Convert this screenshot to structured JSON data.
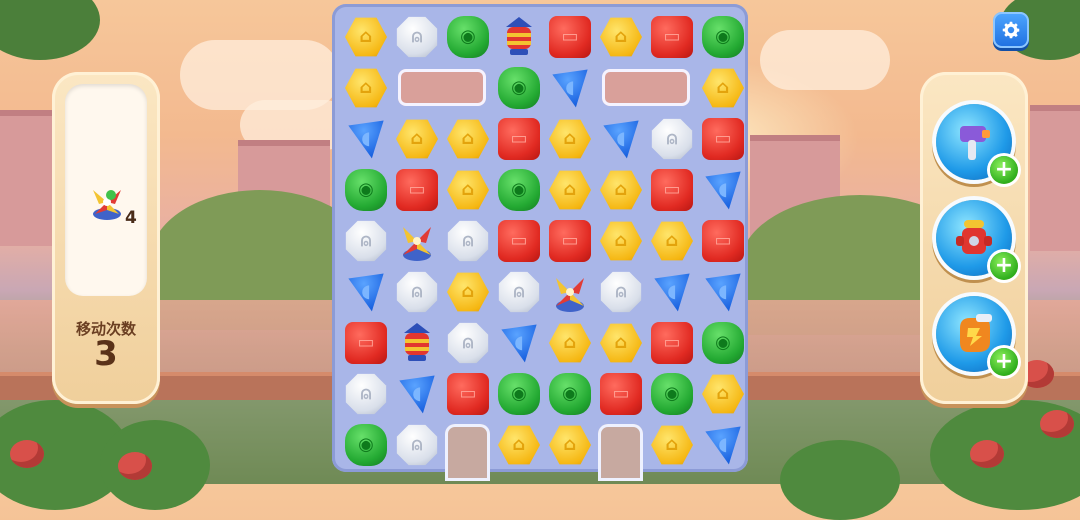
{
  "left_panel": {
    "goal_icon": "pinwheel-icon",
    "goal_count": "4",
    "moves_label": "移动次数",
    "moves_value": "3"
  },
  "settings": {
    "icon": "gear-icon"
  },
  "boosters": [
    {
      "name": "hammer-booster",
      "icon": "hammer-icon",
      "add_label": "+"
    },
    {
      "name": "fire-hydrant-booster",
      "icon": "fire-hydrant-icon",
      "add_label": "+"
    },
    {
      "name": "glove-booster",
      "icon": "glove-icon",
      "add_label": "+"
    }
  ],
  "board": {
    "columns": 8,
    "rows": 9,
    "tiles": [
      [
        "yellow",
        "white",
        "green",
        "lantern",
        "red",
        "yellow",
        "red",
        "green"
      ],
      [
        "yellow",
        "gap",
        "gap",
        "green",
        "blue",
        "gap",
        "gap",
        "yellow"
      ],
      [
        "blue",
        "yellow",
        "yellow",
        "red",
        "yellow",
        "blue",
        "white",
        "red"
      ],
      [
        "green",
        "red",
        "yellow",
        "green",
        "yellow",
        "yellow",
        "red",
        "blue"
      ],
      [
        "white",
        "pinwheel",
        "white",
        "red",
        "red",
        "yellow",
        "yellow",
        "red"
      ],
      [
        "blue",
        "white",
        "yellow",
        "white",
        "pinwheel",
        "white",
        "blue",
        "blue"
      ],
      [
        "red",
        "lantern",
        "white",
        "blue",
        "yellow",
        "yellow",
        "red",
        "green"
      ],
      [
        "white",
        "blue",
        "red",
        "green",
        "green",
        "red",
        "green",
        "yellow"
      ],
      [
        "green",
        "white",
        "none",
        "yellow",
        "yellow",
        "none",
        "yellow",
        "blue"
      ]
    ]
  },
  "colors": {
    "board_bg": "#a9b6e8",
    "panel_bg": "#fbe7c3",
    "accent_blue": "#1e6fe0",
    "plus_green": "#2fae1d"
  }
}
